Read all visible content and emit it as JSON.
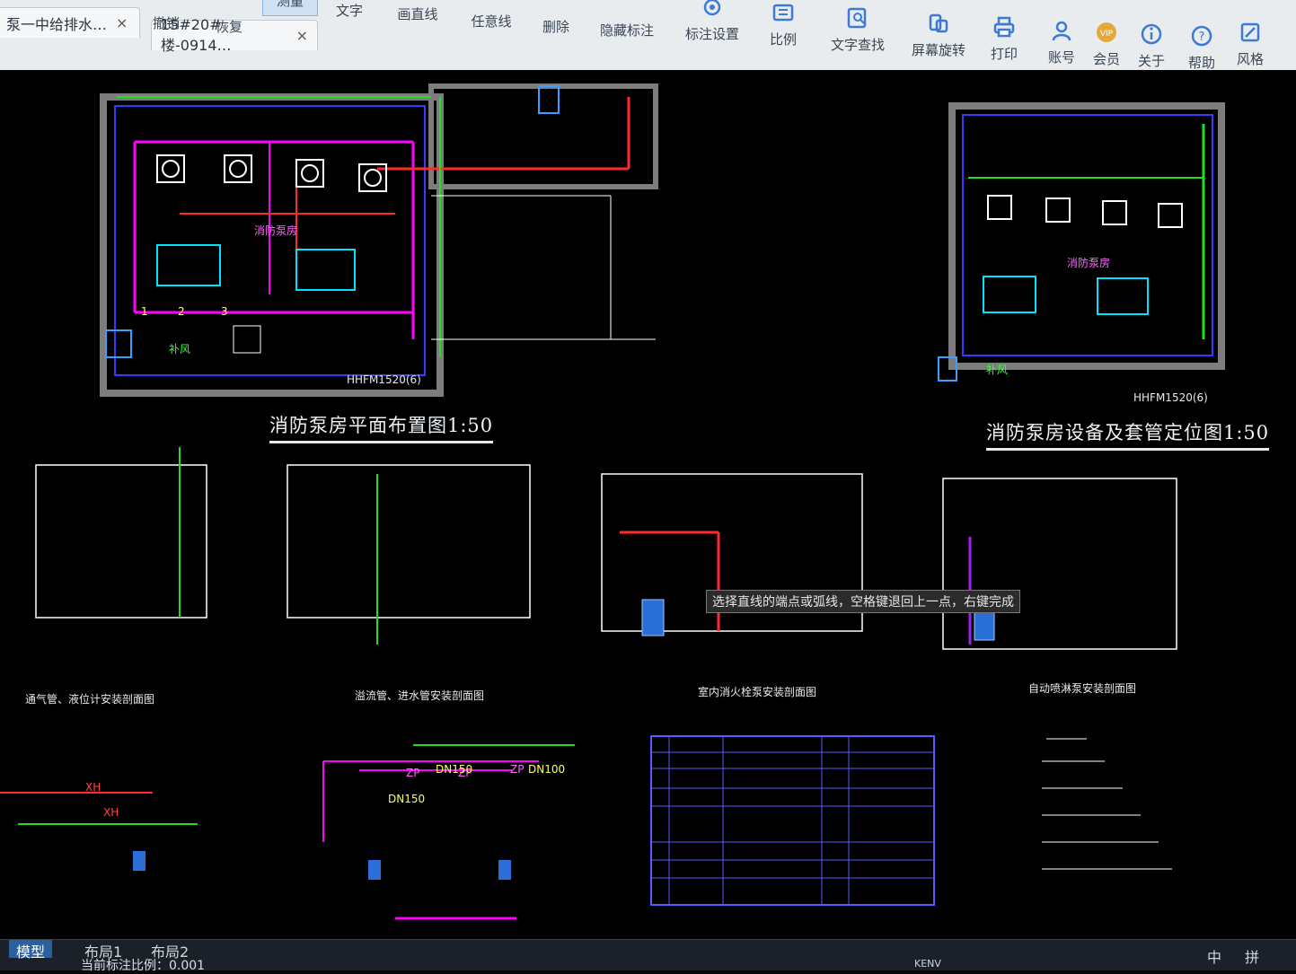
{
  "tabs": [
    {
      "label": "泵一中给排水…",
      "close": "×"
    },
    {
      "label": "15#20#楼-0914…",
      "close": "×"
    }
  ],
  "toolbar": {
    "items": [
      {
        "label": "撤销",
        "icon": "undo-icon"
      },
      {
        "label": "恢复",
        "icon": "redo-icon"
      },
      {
        "label": "测量",
        "icon": "measure-icon",
        "active": true
      },
      {
        "label": "文字",
        "icon": "text-icon"
      },
      {
        "label": "画直线",
        "icon": "line-icon"
      },
      {
        "label": "任意线",
        "icon": "freeline-icon"
      },
      {
        "label": "删除",
        "icon": "delete-icon"
      },
      {
        "label": "隐藏标注",
        "icon": "hide-annotation-icon"
      },
      {
        "label": "标注设置",
        "icon": "annotation-settings-icon"
      },
      {
        "label": "比例",
        "icon": "scale-icon"
      },
      {
        "label": "文字查找",
        "icon": "text-search-icon"
      },
      {
        "label": "屏幕旋转",
        "icon": "rotate-icon"
      },
      {
        "label": "打印",
        "icon": "print-icon"
      },
      {
        "label": "账号",
        "icon": "account-icon"
      },
      {
        "label": "会员",
        "icon": "vip-icon"
      },
      {
        "label": "关于",
        "icon": "about-icon"
      },
      {
        "label": "帮助",
        "icon": "help-icon"
      },
      {
        "label": "风格",
        "icon": "style-icon"
      }
    ]
  },
  "drawing": {
    "title_left": "消防泵房平面布置图1:50",
    "title_right": "消防泵房设备及套管定位图1:50",
    "room_label": "消防泵房",
    "door_label_left": "HHFM1520(6)",
    "door_label_right": "HHFM1520(6)",
    "vent_label": "补风",
    "numbers": [
      "1",
      "2",
      "3"
    ],
    "section_titles": [
      "通气管、液位计安装剖面图",
      "溢流管、进水管安装剖面图",
      "室内消火栓泵安装剖面图",
      "自动喷淋泵安装剖面图"
    ],
    "pipe_labels": [
      "ZP",
      "ZP",
      "ZP",
      "XH",
      "XH",
      "DN150",
      "DN150",
      "DN100"
    ]
  },
  "tooltip": "选择直线的端点或弧线，空格键退回上一点，右键完成",
  "layout_tabs": [
    "模型",
    "布局1",
    "布局2"
  ],
  "status": {
    "label": "当前标注比例：",
    "value": "0.001"
  },
  "tray": {
    "ime": "中",
    "mode": "拼",
    "user": "KENV"
  }
}
